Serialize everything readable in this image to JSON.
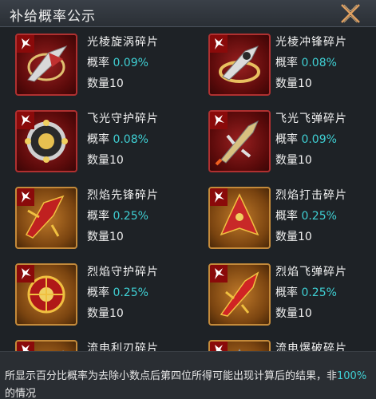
{
  "header": {
    "title": "补给概率公示"
  },
  "labels": {
    "rate_label": "概率",
    "qty_label": "数量"
  },
  "items": [
    {
      "name": "光棱旋涡碎片",
      "rate": "0.09%",
      "qty": "10",
      "frame": "red",
      "icon": "ship-spiral-icon"
    },
    {
      "name": "光棱冲锋碎片",
      "rate": "0.08%",
      "qty": "10",
      "frame": "red",
      "icon": "ship-charge-icon"
    },
    {
      "name": "飞光守护碎片",
      "rate": "0.08%",
      "qty": "10",
      "frame": "red",
      "icon": "orb-guard-icon"
    },
    {
      "name": "飞光飞弹碎片",
      "rate": "0.09%",
      "qty": "10",
      "frame": "red",
      "icon": "ship-missile-icon"
    },
    {
      "name": "烈焰先锋碎片",
      "rate": "0.25%",
      "qty": "10",
      "frame": "orange",
      "icon": "ship-vanguard-icon"
    },
    {
      "name": "烈焰打击碎片",
      "rate": "0.25%",
      "qty": "10",
      "frame": "orange",
      "icon": "ship-strike-icon"
    },
    {
      "name": "烈焰守护碎片",
      "rate": "0.25%",
      "qty": "10",
      "frame": "orange",
      "icon": "orb-flame-guard-icon"
    },
    {
      "name": "烈焰飞弹碎片",
      "rate": "0.25%",
      "qty": "10",
      "frame": "orange",
      "icon": "ship-flame-missile-icon"
    },
    {
      "name": "流电利刃碎片",
      "rate": "",
      "qty": "",
      "frame": "orange",
      "icon": "ship-blade-icon"
    },
    {
      "name": "流电爆破碎片",
      "rate": "",
      "qty": "",
      "frame": "orange",
      "icon": "ship-blast-icon"
    }
  ],
  "footer": {
    "text_before": "所显示百分比概率为去除小数点后第四位所得可能出现计算后的结果，非",
    "highlight": "100%",
    "text_after": "的情况"
  },
  "colors": {
    "accent": "#3fd0d4",
    "close": "#e0a060",
    "frame_red": "#b03030",
    "frame_orange": "#c48a3a"
  }
}
